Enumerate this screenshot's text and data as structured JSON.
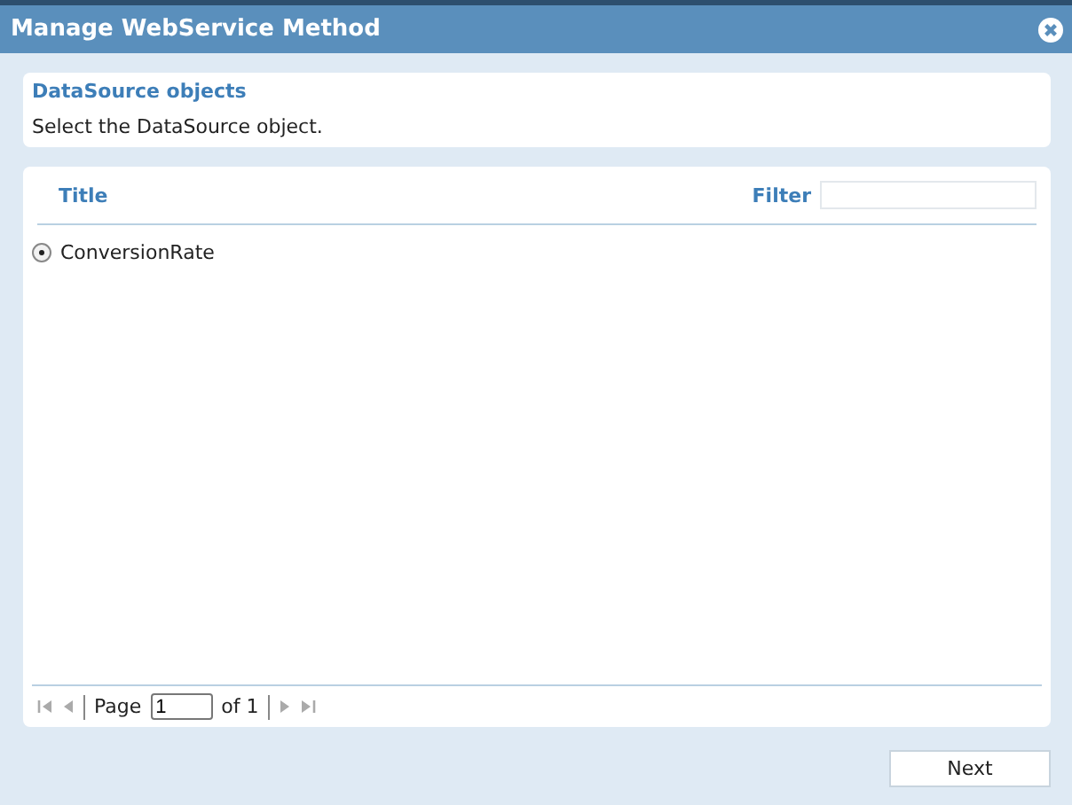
{
  "window": {
    "title": "Manage WebService Method"
  },
  "info": {
    "heading": "DataSource objects",
    "text": "Select the DataSource object."
  },
  "grid": {
    "column": "Title",
    "filter_label": "Filter",
    "rows": [
      {
        "title": "ConversionRate",
        "selected": true
      }
    ],
    "pager": {
      "page_label": "Page",
      "page": "1",
      "of_label": "of 1"
    }
  },
  "buttons": [
    "Next"
  ]
}
